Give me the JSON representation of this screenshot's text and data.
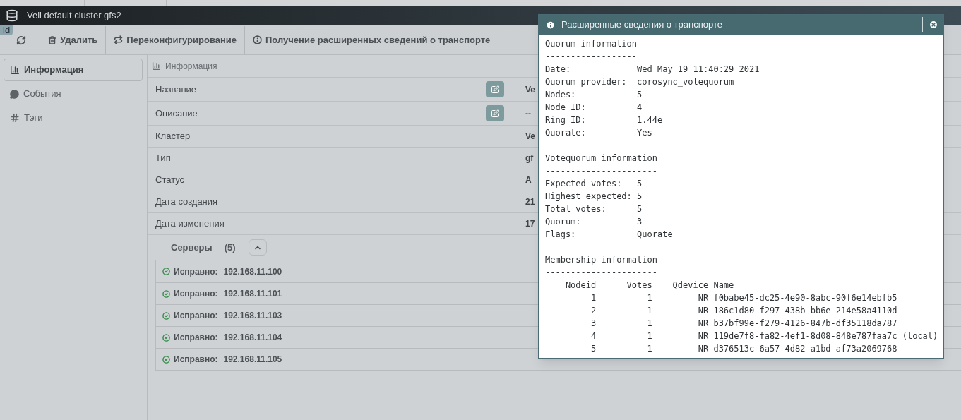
{
  "window": {
    "title": "Veil default cluster gfs2",
    "badge": "id"
  },
  "toolbar": [
    {
      "kind": "refresh"
    },
    {
      "kind": "delete",
      "label": "Удалить"
    },
    {
      "kind": "reconfigure",
      "label": "Переконфигурирование"
    },
    {
      "kind": "info",
      "label": "Получение расширенных сведений о транспорте"
    }
  ],
  "sidebar": {
    "items": [
      {
        "kind": "chart",
        "label": "Информация",
        "selected": true
      },
      {
        "kind": "comment",
        "label": "События",
        "selected": false
      },
      {
        "kind": "hash",
        "label": "Тэги",
        "selected": false
      }
    ]
  },
  "panel": {
    "title": "Информация",
    "rows": [
      {
        "label": "Название",
        "editable": true,
        "value": "Ve"
      },
      {
        "label": "Описание",
        "editable": true,
        "value": "--"
      },
      {
        "label": "Кластер",
        "editable": false,
        "value": "Ve"
      },
      {
        "label": "Тип",
        "editable": false,
        "value": "gf"
      },
      {
        "label": "Статус",
        "editable": false,
        "value": "A"
      },
      {
        "label": "Дата создания",
        "editable": false,
        "value": "21"
      },
      {
        "label": "Дата изменения",
        "editable": false,
        "value": "17"
      }
    ],
    "servers": {
      "title": "Серверы",
      "count": "(5)",
      "expanded": true,
      "items": [
        {
          "status": "Исправно:",
          "address": "192.168.11.100"
        },
        {
          "status": "Исправно:",
          "address": "192.168.11.101"
        },
        {
          "status": "Исправно:",
          "address": "192.168.11.103"
        },
        {
          "status": "Исправно:",
          "address": "192.168.11.104"
        },
        {
          "status": "Исправно:",
          "address": "192.168.11.105"
        }
      ]
    }
  },
  "dialog": {
    "title": "Расширенные сведения о транспорте",
    "blocks": [
      [
        "Quorum information",
        "------------------",
        "Date:             Wed May 19 11:40:29 2021",
        "Quorum provider:  corosync_votequorum",
        "Nodes:            5",
        "Node ID:          4",
        "Ring ID:          1.44e",
        "Quorate:          Yes"
      ],
      [
        "Votequorum information",
        "----------------------",
        "Expected votes:   5",
        "Highest expected: 5",
        "Total votes:      5",
        "Quorum:           3",
        "Flags:            Quorate"
      ],
      [
        "Membership information",
        "----------------------",
        "    Nodeid      Votes    Qdevice Name",
        "         1          1         NR f0babe45-dc25-4e90-8abc-90f6e14ebfb5",
        "         2          1         NR 186c1d80-f297-438b-bb6e-214e58a4110d",
        "         3          1         NR b37bf99e-f279-4126-847b-df35118da787",
        "         4          1         NR 119de7f8-fa82-4ef1-8d08-848e787faa7c (local)",
        "         5          1         NR d376513c-6a57-4d82-a1bd-af73a2069768"
      ]
    ]
  }
}
